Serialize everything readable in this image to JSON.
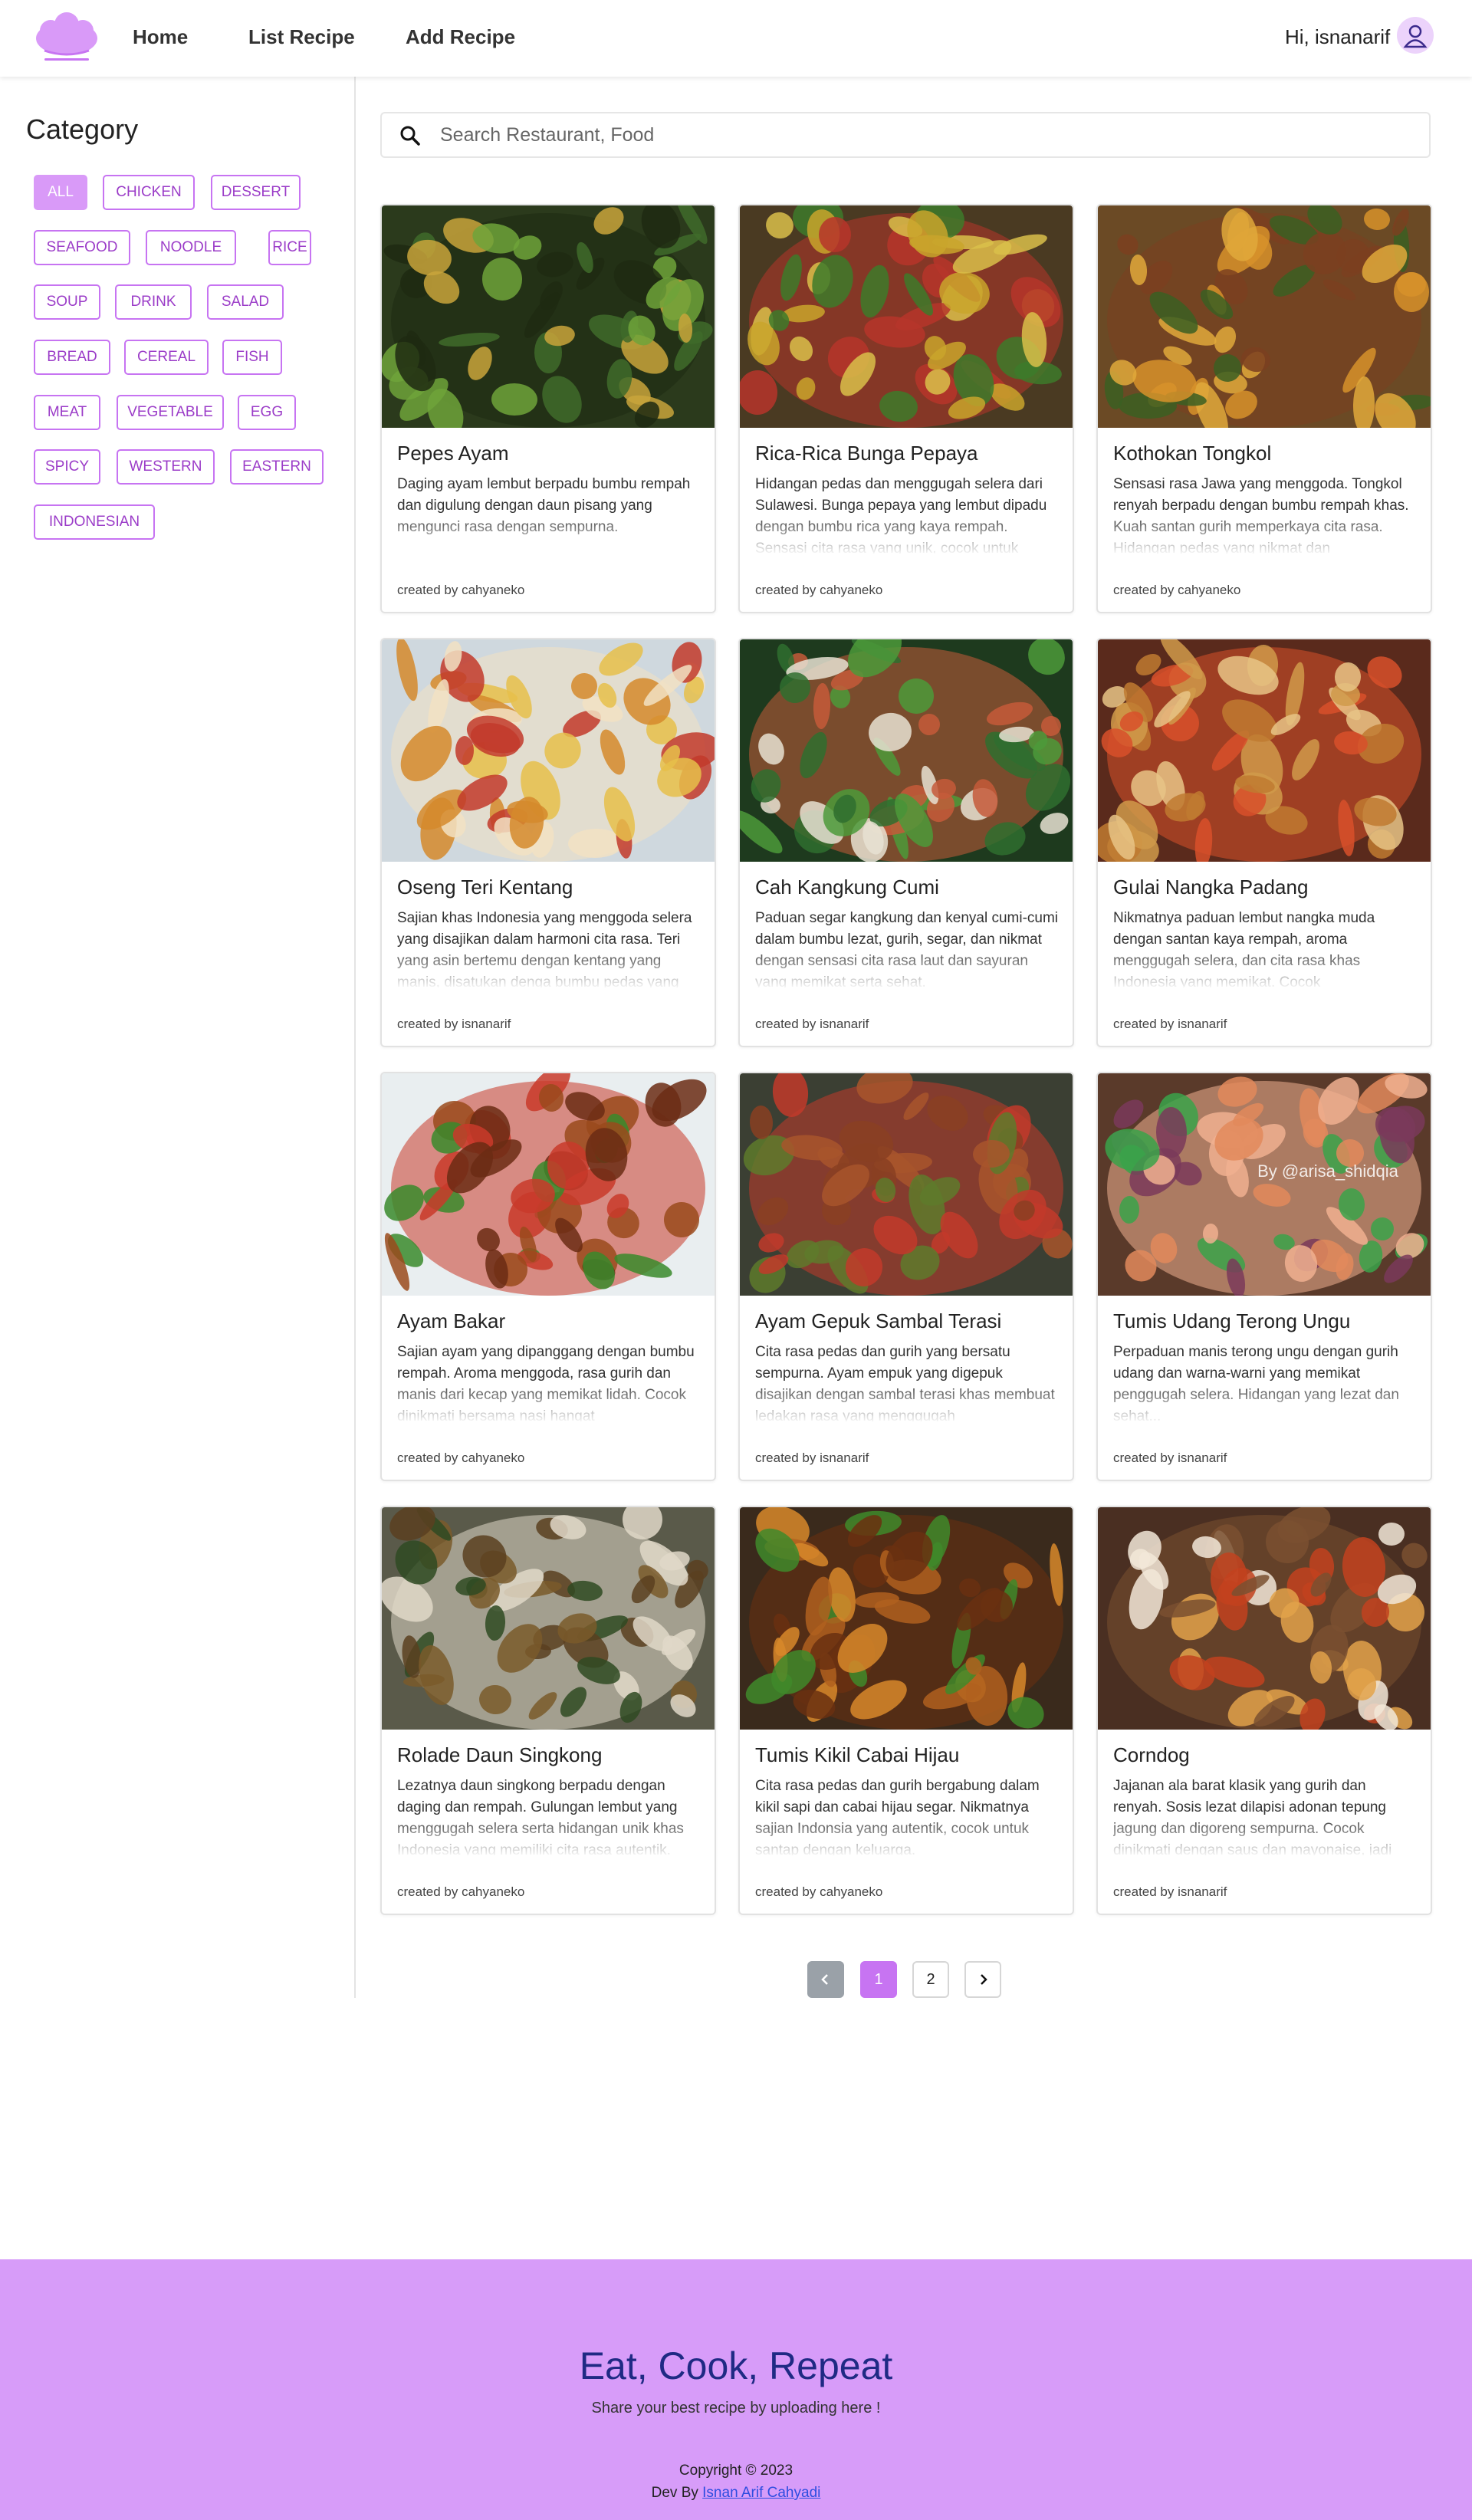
{
  "header": {
    "nav": [
      "Home",
      "List Recipe",
      "Add Recipe"
    ],
    "greeting": "Hi, isnanarif"
  },
  "sidebar": {
    "title": "Category",
    "categories": [
      "ALL",
      "CHICKEN",
      "DESSERT",
      "SEAFOOD",
      "NOODLE",
      "RICE",
      "SOUP",
      "DRINK",
      "SALAD",
      "BREAD",
      "CEREAL",
      "FISH",
      "MEAT",
      "VEGETABLE",
      "EGG",
      "SPICY",
      "WESTERN",
      "EASTERN",
      "INDONESIAN"
    ],
    "active_category": "ALL"
  },
  "search": {
    "placeholder": "Search Restaurant, Food"
  },
  "recipes": [
    {
      "title": "Pepes Ayam",
      "desc": "Daging ayam lembut berpadu bumbu rempah dan digulung dengan daun pisang yang mengunci rasa dengan sempurna.",
      "author": "created by cahyaneko"
    },
    {
      "title": "Rica-Rica Bunga Pepaya",
      "desc": "Hidangan pedas dan menggugah selera dari Sulawesi. Bunga pepaya yang lembut dipadu dengan bumbu rica yang kaya rempah. Sensasi cita rasa yang unik, cocok untuk",
      "author": "created by cahyaneko"
    },
    {
      "title": "Kothokan Tongkol",
      "desc": "Sensasi rasa Jawa yang menggoda. Tongkol renyah berpadu dengan bumbu rempah khas. Kuah santan gurih memperkaya cita rasa. Hidangan pedas yang nikmat dan",
      "author": "created by cahyaneko"
    },
    {
      "title": "Oseng Teri Kentang",
      "desc": "Sajian khas Indonesia yang menggoda selera yang disajikan dalam harmoni cita rasa. Teri yang asin bertemu dengan kentang yang manis, disatukan denga bumbu pedas yang",
      "author": "created by isnanarif"
    },
    {
      "title": "Cah Kangkung Cumi",
      "desc": "Paduan segar kangkung dan kenyal cumi-cumi dalam bumbu lezat, gurih, segar, dan nikmat dengan sensasi cita rasa laut dan sayuran yang memikat serta sehat.",
      "author": "created by isnanarif"
    },
    {
      "title": "Gulai Nangka Padang",
      "desc": "Nikmatnya paduan lembut nangka muda dengan santan kaya rempah, aroma menggugah selera, dan cita rasa khas Indonesia yang memikat. Cocok",
      "author": "created by isnanarif"
    },
    {
      "title": "Ayam Bakar",
      "desc": "Sajian ayam yang dipanggang dengan bumbu rempah. Aroma menggoda, rasa gurih dan manis dari kecap yang memikat lidah. Cocok dinikmati bersama nasi hangat",
      "author": "created by cahyaneko"
    },
    {
      "title": "Ayam Gepuk Sambal Terasi",
      "desc": "Cita rasa pedas dan gurih yang bersatu sempurna. Ayam empuk yang digepuk disajikan dengan sambal terasi khas membuat ledakan rasa yang menggugah",
      "author": "created by isnanarif"
    },
    {
      "title": "Tumis Udang Terong Ungu",
      "desc": "Perpaduan manis terong ungu dengan gurih udang dan warna-warni yang memikat penggugah selera. Hidangan yang lezat dan sehat...",
      "author": "created by isnanarif",
      "watermark": "By @arisa_shidqia"
    },
    {
      "title": "Rolade Daun Singkong",
      "desc": "Lezatnya daun singkong berpadu dengan daging dan rempah. Gulungan lembut yang menggugah selera serta hidangan unik khas Indonesia yang memiliki cita rasa autentik.",
      "author": "created by cahyaneko"
    },
    {
      "title": "Tumis Kikil Cabai Hijau",
      "desc": "Cita rasa pedas dan gurih bergabung dalam kikil sapi dan cabai hijau segar. Nikmatnya sajian Indonsia yang autentik, cocok untuk santap dengan keluarga.",
      "author": "created by cahyaneko"
    },
    {
      "title": "Corndog",
      "desc": "Jajanan ala barat klasik yang gurih dan renyah. Sosis lezat dilapisi adonan tepung jagung dan digoreng sempurna. Cocok dinikmati dengan saus dan mayonaise, jadi",
      "author": "created by isnanarif"
    }
  ],
  "pagination": {
    "pages": [
      "1",
      "2"
    ],
    "current": "1"
  },
  "footer": {
    "title": "Eat, Cook, Repeat",
    "subtitle": "Share your best recipe by uploading here !",
    "copyright": "Copyright © 2023",
    "dev_prefix": "Dev By",
    "dev_name": "Isnan Arif Cahyadi"
  },
  "colors": {
    "accent": "#c774f2",
    "chip_active": "#d99af8",
    "footer_bg": "#d79cf9",
    "footer_title": "#1f2a84"
  }
}
